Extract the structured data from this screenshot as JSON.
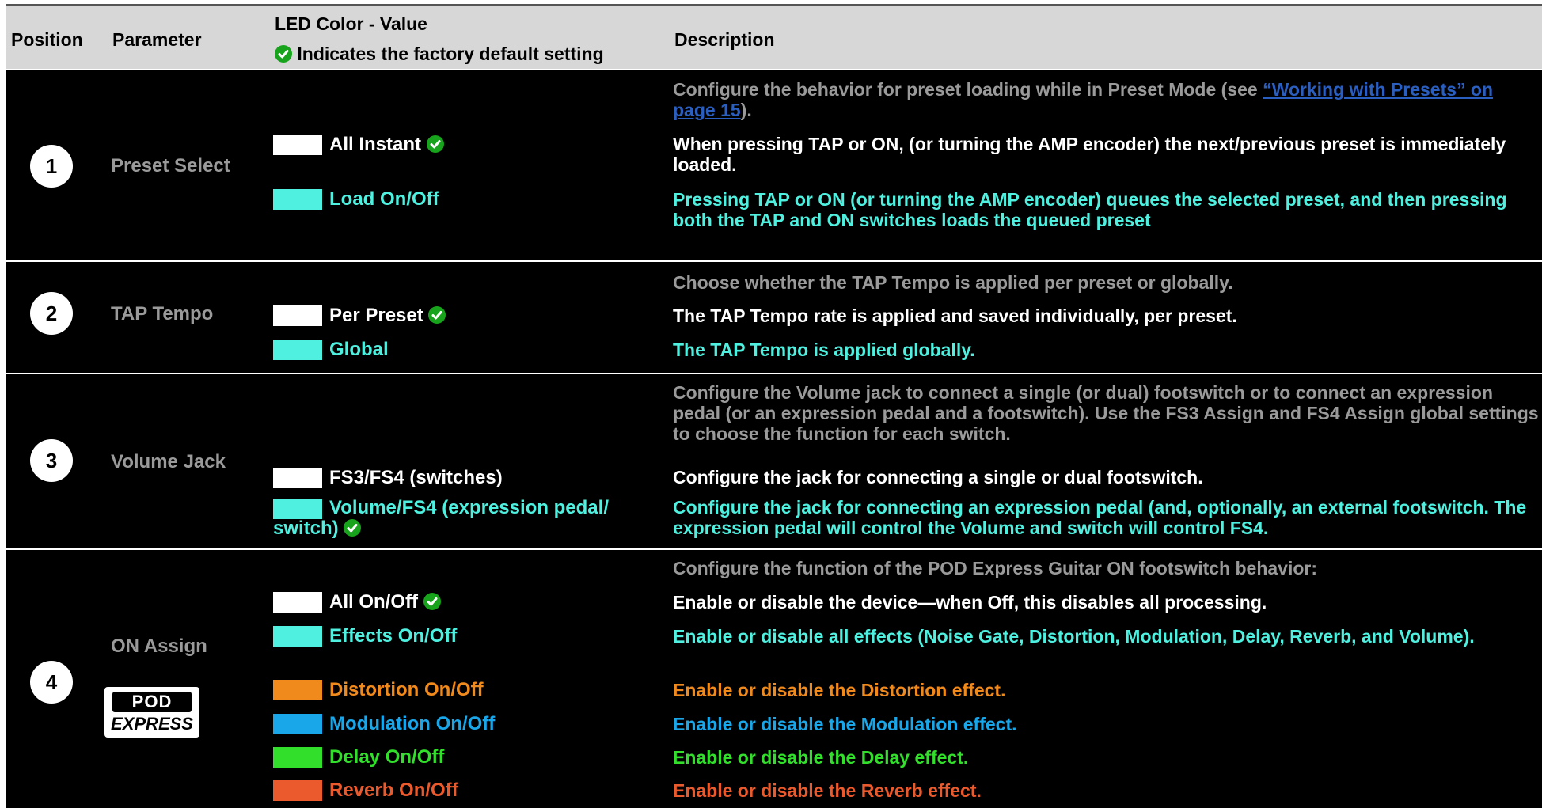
{
  "header": {
    "position": "Position",
    "parameter": "Parameter",
    "led_title": "LED Color - Value",
    "led_note": "Indicates the factory default setting",
    "description": "Description"
  },
  "rows": [
    {
      "number": "1",
      "parameter": "Preset Select",
      "intro": "Configure the behavior for preset loading while in Preset Mode (see ",
      "intro_link": "“Working with Presets” on page 15",
      "intro_end": ").",
      "values": [
        {
          "label": "All Instant",
          "color": "#ffffff",
          "default": true,
          "description": "When pressing TAP or ON, (or turning the AMP encoder) the next/previous preset is immediately loaded."
        },
        {
          "label": "Load On/Off",
          "color": "#4ff0e0",
          "default": false,
          "description": "Pressing TAP or ON (or turning the AMP encoder) queues the selected preset, and then pressing both the TAP and ON switches loads the queued preset"
        }
      ]
    },
    {
      "number": "2",
      "parameter": "TAP Tempo",
      "intro": "Choose whether the TAP Tempo is applied per preset or globally.",
      "values": [
        {
          "label": "Per Preset",
          "color": "#ffffff",
          "default": true,
          "description": "The TAP Tempo rate is applied and saved individually, per preset."
        },
        {
          "label": "Global",
          "color": "#4ff0e0",
          "default": false,
          "description": "The TAP Tempo is applied globally."
        }
      ]
    },
    {
      "number": "3",
      "parameter": "Volume Jack",
      "intro": "Configure the Volume jack to connect a single (or dual) footswitch or to connect an expression pedal (or an expression pedal and a footswitch). Use the FS3 Assign and FS4 Assign global settings to choose the function for each switch.",
      "values": [
        {
          "label": "FS3/FS4 (switches)",
          "color": "#ffffff",
          "default": false,
          "description": "Configure the jack for connecting a single or dual footswitch."
        },
        {
          "label": "Volume/FS4 (expression pedal/",
          "label2": "switch)",
          "color": "#4ff0e0",
          "default": true,
          "description": "Configure the jack for connecting an expression pedal (and, optionally, an external footswitch. The expression pedal will control the Volume and switch will control FS4."
        }
      ]
    },
    {
      "number": "4",
      "parameter": "ON Assign",
      "logo_top": "POD",
      "logo_bottom": "EXPRESS",
      "intro": "Configure the function of the POD Express Guitar ON footswitch behavior:",
      "values": [
        {
          "label": "All On/Off",
          "color": "#ffffff",
          "default": true,
          "description": "Enable or disable the device—when Off, this disables all processing."
        },
        {
          "label": "Effects On/Off",
          "color": "#4ff0e0",
          "default": false,
          "description": "Enable or disable all effects (Noise Gate, Distortion, Modulation, Delay, Reverb, and Volume)."
        },
        {
          "label": "Distortion On/Off",
          "color": "#f08a1c",
          "default": false,
          "description": "Enable or disable the Distortion effect."
        },
        {
          "label": "Modulation On/Off",
          "color": "#1aa7ea",
          "default": false,
          "description": "Enable or disable the Modulation effect."
        },
        {
          "label": "Delay On/Off",
          "color": "#32e02c",
          "default": false,
          "description": "Enable or disable the Delay effect."
        },
        {
          "label": "Reverb On/Off",
          "color": "#ea5a2c",
          "default": false,
          "description": "Enable or disable the Reverb effect."
        }
      ]
    }
  ]
}
